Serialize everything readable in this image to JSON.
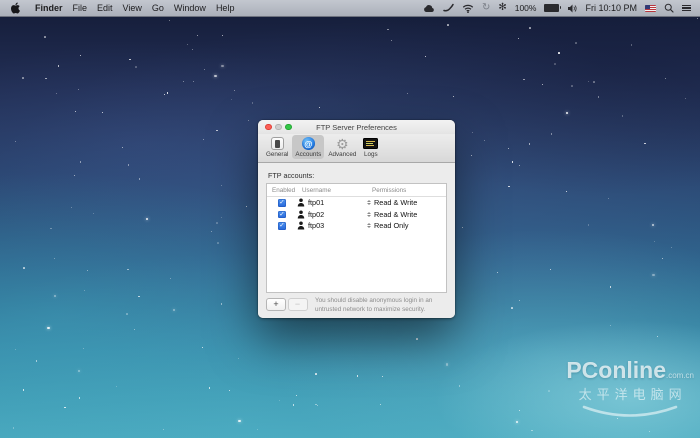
{
  "menu_bar": {
    "menus": [
      "Finder",
      "File",
      "Edit",
      "View",
      "Go",
      "Window",
      "Help"
    ],
    "battery_percent": "100%",
    "clock": "Fri 10:10 PM"
  },
  "window": {
    "title": "FTP Server Preferences",
    "toolbar": {
      "tabs": [
        {
          "label": "General",
          "icon": "general-device-icon",
          "selected": false
        },
        {
          "label": "Accounts",
          "icon": "accounts-at-icon",
          "selected": true
        },
        {
          "label": "Advanced",
          "icon": "gear-icon",
          "selected": false
        },
        {
          "label": "Logs",
          "icon": "logs-terminal-icon",
          "selected": false
        }
      ]
    },
    "content": {
      "section_label": "FTP accounts:",
      "table": {
        "columns": [
          "Enabled",
          "Username",
          "Permissions"
        ],
        "rows": [
          {
            "enabled": true,
            "username": "ftp01",
            "permissions": "Read & Write"
          },
          {
            "enabled": true,
            "username": "ftp02",
            "permissions": "Read & Write"
          },
          {
            "enabled": true,
            "username": "ftp03",
            "permissions": "Read Only"
          }
        ]
      },
      "add_label": "+",
      "remove_label": "−",
      "warning": "You should disable anonymous login in an untrusted network to maximize security."
    }
  },
  "watermark": {
    "brand": "PConline",
    "suffix": ".com.cn",
    "chinese": "太平洋电脑网"
  },
  "colors": {
    "checkbox_blue": "#2f6fe4",
    "selected_tab_grey": "#c7c7c7",
    "traffic_red": "#fc5f57",
    "traffic_green": "#34c748",
    "sky_top": "#131b35",
    "sea_bottom": "#48a7bd"
  }
}
